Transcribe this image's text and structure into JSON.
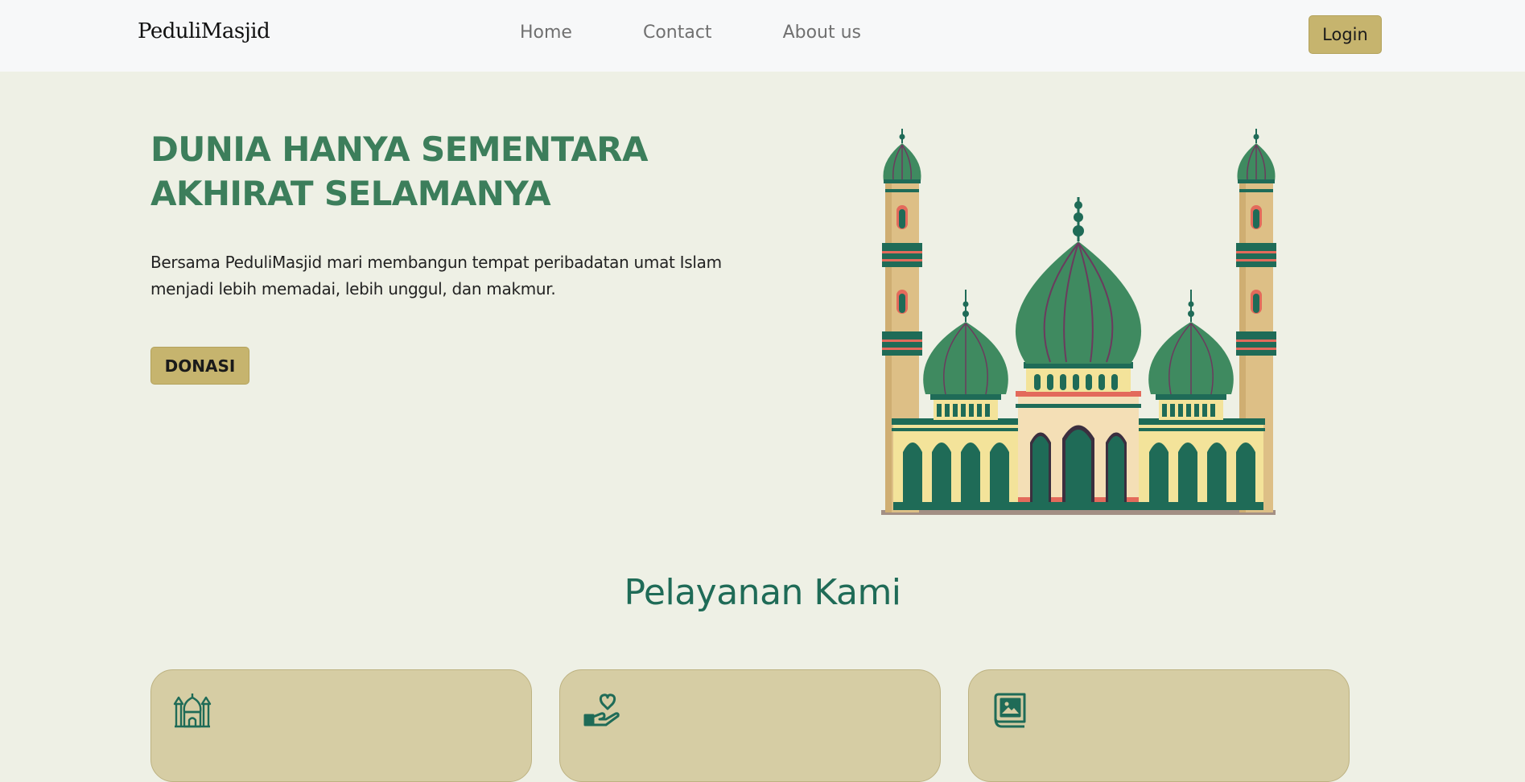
{
  "navbar": {
    "brand": "PeduliMasjid",
    "links": [
      "Home",
      "Contact",
      "About us"
    ],
    "login_label": "Login"
  },
  "hero": {
    "title_lines": [
      "DUNIA HANYA SEMENTARA",
      "AKHIRAT SELAMANYA"
    ],
    "text_lines": [
      "Bersama PeduliMasjid mari membangun tempat peribadatan umat Islam",
      "menjadi lebih memadai, lebih unggul, dan makmur."
    ],
    "cta_label": "DONASI",
    "illustration": "mosque-illustration"
  },
  "services": {
    "title": "Pelayanan Kami",
    "cards": [
      {
        "icon": "mosque-icon"
      },
      {
        "icon": "hand-heart-icon"
      },
      {
        "icon": "image-icon"
      }
    ]
  },
  "colors": {
    "background": "#eef0e5",
    "navbar": "#f7f8f9",
    "accent_button": "#c6b46e",
    "hero_title": "#3c7e5b",
    "section_title": "#1f6b57",
    "card": "#d6cda4",
    "icon": "#1f6b57"
  }
}
